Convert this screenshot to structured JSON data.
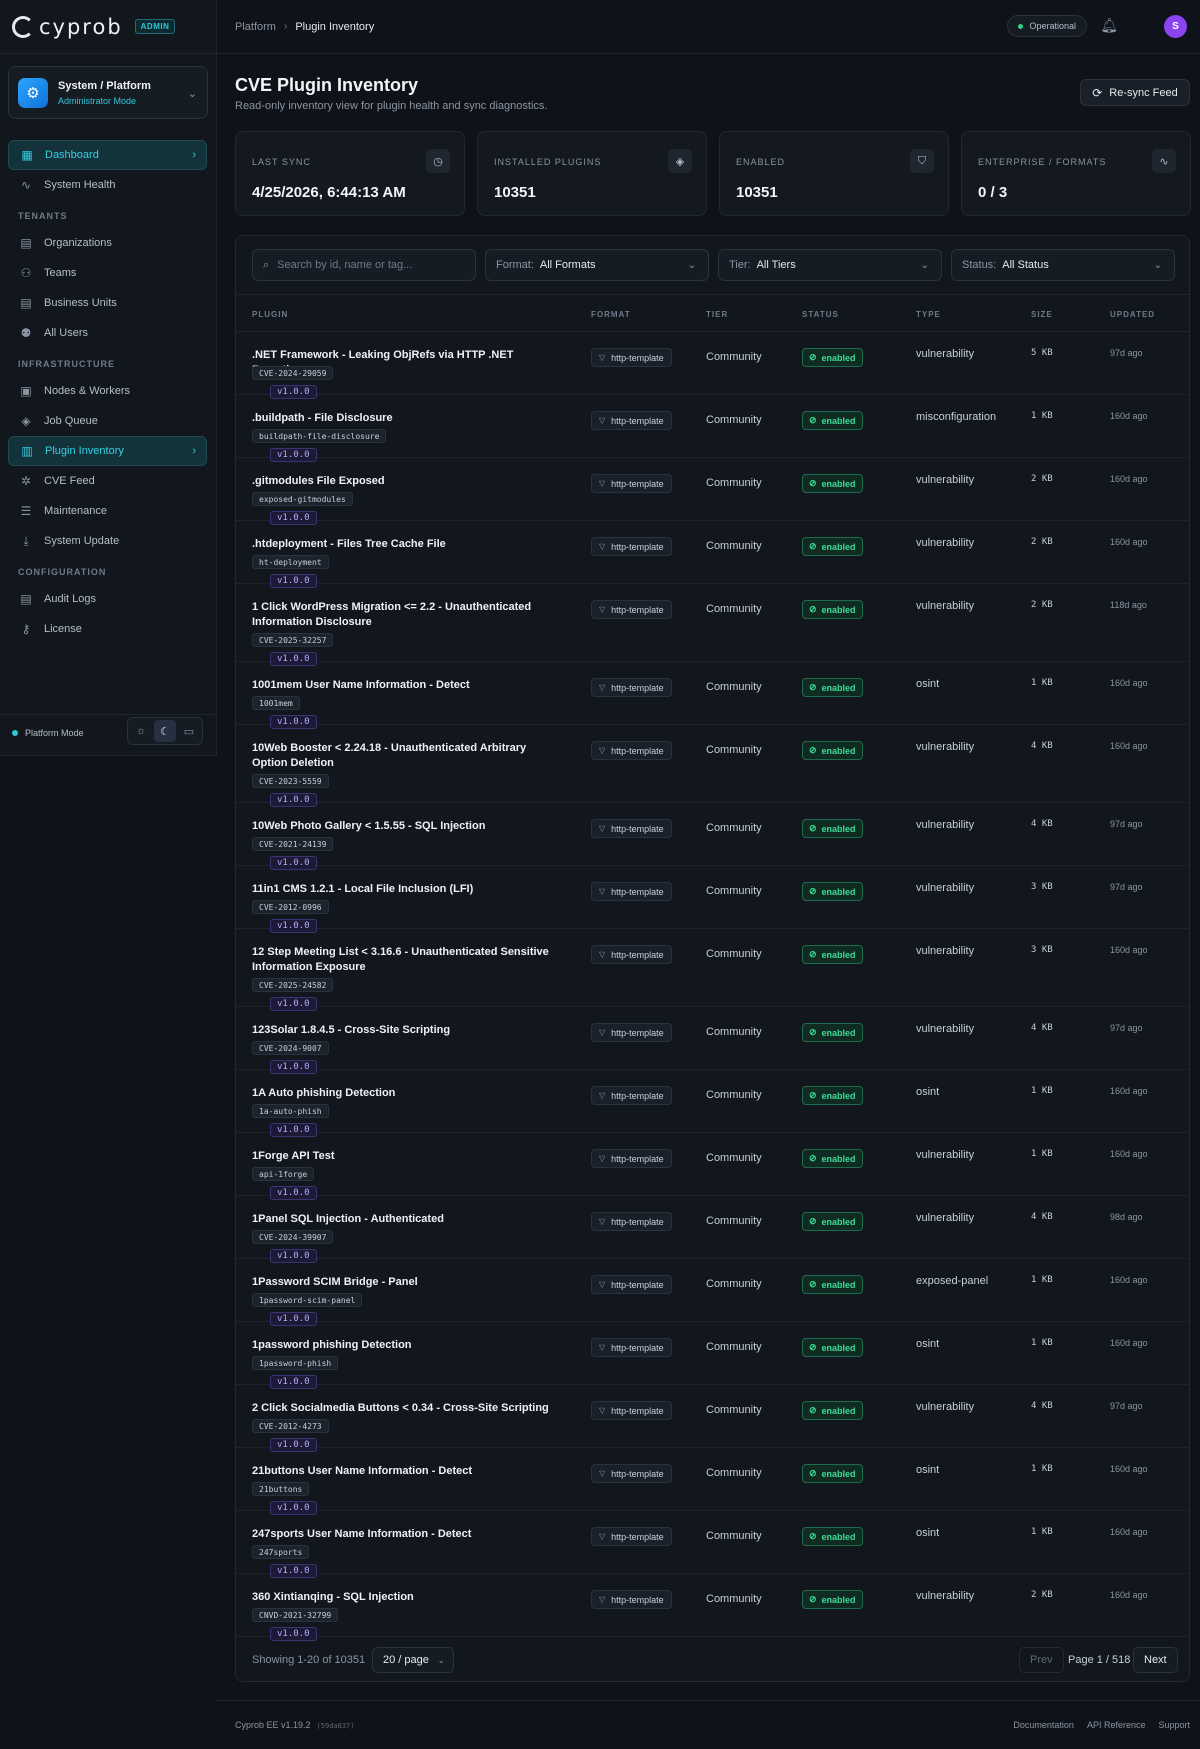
{
  "brand": {
    "name": "cyprob",
    "badge": "ADMIN"
  },
  "tenant": {
    "title": "System / Platform",
    "subtitle": "Administrator Mode"
  },
  "sidebar": {
    "dashboard": "Dashboard",
    "system_health": "System Health",
    "sec_tenants": "TENANTS",
    "organizations": "Organizations",
    "teams": "Teams",
    "business_units": "Business Units",
    "all_users": "All Users",
    "sec_infra": "INFRASTRUCTURE",
    "nodes_workers": "Nodes & Workers",
    "job_queue": "Job Queue",
    "plugin_inventory": "Plugin Inventory",
    "cve_feed": "CVE Feed",
    "maintenance": "Maintenance",
    "system_update": "System Update",
    "sec_config": "CONFIGURATION",
    "audit_logs": "Audit Logs",
    "license": "License",
    "platform_mode": "Platform Mode"
  },
  "topbar": {
    "crumb_root": "Platform",
    "crumb_current": "Plugin Inventory",
    "status": "Operational",
    "avatar": "S"
  },
  "header": {
    "title": "CVE Plugin Inventory",
    "subtitle": "Read-only inventory view for plugin health and sync diagnostics.",
    "resync": "Re-sync Feed"
  },
  "stats": [
    {
      "label": "LAST SYNC",
      "value": "4/25/2026, 6:44:13 AM",
      "icon": "clock-icon"
    },
    {
      "label": "INSTALLED PLUGINS",
      "value": "10351",
      "icon": "layers-icon"
    },
    {
      "label": "ENABLED",
      "value": "10351",
      "icon": "shield-icon"
    },
    {
      "label": "ENTERPRISE / FORMATS",
      "value": "0 / 3",
      "icon": "activity-icon"
    }
  ],
  "filters": {
    "search_placeholder": "Search by id, name or tag...",
    "format_label": "Format:",
    "format_value": "All Formats",
    "tier_label": "Tier:",
    "tier_value": "All Tiers",
    "status_label": "Status:",
    "status_value": "All Status"
  },
  "columns": {
    "plugin": "PLUGIN",
    "format": "FORMAT",
    "tier": "TIER",
    "status": "STATUS",
    "type": "TYPE",
    "size": "SIZE",
    "updated": "UPDATED"
  },
  "rows": [
    {
      "name": ".NET Framework - Leaking ObjRefs via HTTP .NET Remoting",
      "id": "CVE-2024-29059",
      "version": "v1.0.0",
      "format": "http-template",
      "tier": "Community",
      "status": "enabled",
      "type": "vulnerability",
      "size": "5 KB",
      "updated": "97d ago"
    },
    {
      "name": ".buildpath - File Disclosure",
      "id": "buildpath-file-disclosure",
      "version": "v1.0.0",
      "format": "http-template",
      "tier": "Community",
      "status": "enabled",
      "type": "misconfiguration",
      "size": "1 KB",
      "updated": "160d ago"
    },
    {
      "name": ".gitmodules File Exposed",
      "id": "exposed-gitmodules",
      "version": "v1.0.0",
      "format": "http-template",
      "tier": "Community",
      "status": "enabled",
      "type": "vulnerability",
      "size": "2 KB",
      "updated": "160d ago"
    },
    {
      "name": ".htdeployment - Files Tree Cache File",
      "id": "ht-deployment",
      "version": "v1.0.0",
      "format": "http-template",
      "tier": "Community",
      "status": "enabled",
      "type": "vulnerability",
      "size": "2 KB",
      "updated": "160d ago"
    },
    {
      "name": "1 Click WordPress Migration <= 2.2 - Unauthenticated Information Disclosure",
      "id": "CVE-2025-32257",
      "version": "v1.0.0",
      "format": "http-template",
      "tier": "Community",
      "status": "enabled",
      "type": "vulnerability",
      "size": "2 KB",
      "updated": "118d ago"
    },
    {
      "name": "1001mem User Name Information - Detect",
      "id": "1001mem",
      "version": "v1.0.0",
      "format": "http-template",
      "tier": "Community",
      "status": "enabled",
      "type": "osint",
      "size": "1 KB",
      "updated": "160d ago"
    },
    {
      "name": "10Web Booster < 2.24.18 - Unauthenticated Arbitrary Option Deletion",
      "id": "CVE-2023-5559",
      "version": "v1.0.0",
      "format": "http-template",
      "tier": "Community",
      "status": "enabled",
      "type": "vulnerability",
      "size": "4 KB",
      "updated": "160d ago"
    },
    {
      "name": "10Web Photo Gallery < 1.5.55 - SQL Injection",
      "id": "CVE-2021-24139",
      "version": "v1.0.0",
      "format": "http-template",
      "tier": "Community",
      "status": "enabled",
      "type": "vulnerability",
      "size": "4 KB",
      "updated": "97d ago"
    },
    {
      "name": "11in1 CMS 1.2.1 - Local File Inclusion (LFI)",
      "id": "CVE-2012-0996",
      "version": "v1.0.0",
      "format": "http-template",
      "tier": "Community",
      "status": "enabled",
      "type": "vulnerability",
      "size": "3 KB",
      "updated": "97d ago"
    },
    {
      "name": "12 Step Meeting List < 3.16.6 - Unauthenticated Sensitive Information Exposure",
      "id": "CVE-2025-24582",
      "version": "v1.0.0",
      "format": "http-template",
      "tier": "Community",
      "status": "enabled",
      "type": "vulnerability",
      "size": "3 KB",
      "updated": "160d ago"
    },
    {
      "name": "123Solar 1.8.4.5 - Cross-Site Scripting",
      "id": "CVE-2024-9007",
      "version": "v1.0.0",
      "format": "http-template",
      "tier": "Community",
      "status": "enabled",
      "type": "vulnerability",
      "size": "4 KB",
      "updated": "97d ago"
    },
    {
      "name": "1A Auto phishing Detection",
      "id": "1a-auto-phish",
      "version": "v1.0.0",
      "format": "http-template",
      "tier": "Community",
      "status": "enabled",
      "type": "osint",
      "size": "1 KB",
      "updated": "160d ago"
    },
    {
      "name": "1Forge API Test",
      "id": "api-1forge",
      "version": "v1.0.0",
      "format": "http-template",
      "tier": "Community",
      "status": "enabled",
      "type": "vulnerability",
      "size": "1 KB",
      "updated": "160d ago"
    },
    {
      "name": "1Panel SQL Injection - Authenticated",
      "id": "CVE-2024-39907",
      "version": "v1.0.0",
      "format": "http-template",
      "tier": "Community",
      "status": "enabled",
      "type": "vulnerability",
      "size": "4 KB",
      "updated": "98d ago"
    },
    {
      "name": "1Password SCIM Bridge - Panel",
      "id": "1password-scim-panel",
      "version": "v1.0.0",
      "format": "http-template",
      "tier": "Community",
      "status": "enabled",
      "type": "exposed-panel",
      "size": "1 KB",
      "updated": "160d ago"
    },
    {
      "name": "1password phishing Detection",
      "id": "1password-phish",
      "version": "v1.0.0",
      "format": "http-template",
      "tier": "Community",
      "status": "enabled",
      "type": "osint",
      "size": "1 KB",
      "updated": "160d ago"
    },
    {
      "name": "2 Click Socialmedia Buttons < 0.34 - Cross-Site Scripting",
      "id": "CVE-2012-4273",
      "version": "v1.0.0",
      "format": "http-template",
      "tier": "Community",
      "status": "enabled",
      "type": "vulnerability",
      "size": "4 KB",
      "updated": "97d ago"
    },
    {
      "name": "21buttons User Name Information - Detect",
      "id": "21buttons",
      "version": "v1.0.0",
      "format": "http-template",
      "tier": "Community",
      "status": "enabled",
      "type": "osint",
      "size": "1 KB",
      "updated": "160d ago"
    },
    {
      "name": "247sports User Name Information - Detect",
      "id": "247sports",
      "version": "v1.0.0",
      "format": "http-template",
      "tier": "Community",
      "status": "enabled",
      "type": "osint",
      "size": "1 KB",
      "updated": "160d ago"
    },
    {
      "name": "360 Xintianqing - SQL Injection",
      "id": "CNVD-2021-32799",
      "version": "v1.0.0",
      "format": "http-template",
      "tier": "Community",
      "status": "enabled",
      "type": "vulnerability",
      "size": "2 KB",
      "updated": "160d ago"
    }
  ],
  "pagination": {
    "showing": "Showing 1-20 of 10351",
    "per_page": "20 / page",
    "prev": "Prev",
    "page": "Page 1 / 518",
    "next": "Next"
  },
  "footer": {
    "version": "Cyprob EE v1.19.2",
    "build": "(59da837)",
    "docs": "Documentation",
    "api": "API Reference",
    "support": "Support"
  }
}
